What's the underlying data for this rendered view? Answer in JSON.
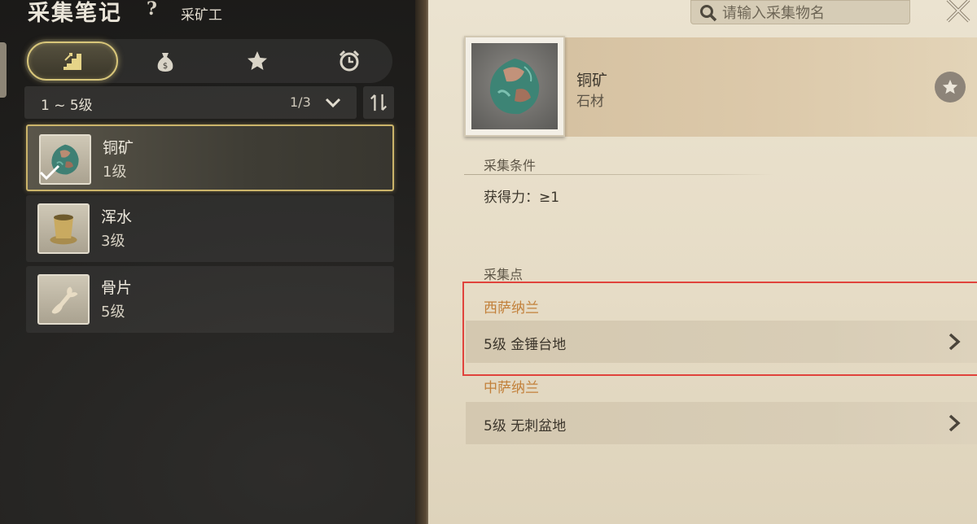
{
  "header": {
    "title": "采集笔记",
    "help_label": "?",
    "profession": "采矿工"
  },
  "tabs": [
    {
      "icon": "level-stairs-icon",
      "active": true
    },
    {
      "icon": "money-bag-icon",
      "active": false
    },
    {
      "icon": "star-icon",
      "active": false
    },
    {
      "icon": "alarm-clock-icon",
      "active": false
    }
  ],
  "filter": {
    "level_range": "1 ~ 5级",
    "page": "1/3"
  },
  "items": [
    {
      "name": "铜矿",
      "level": "1级",
      "icon": "copper-ore-icon",
      "selected": true,
      "checked": true
    },
    {
      "name": "浑水",
      "level": "3级",
      "icon": "muddy-water-cup-icon",
      "selected": false,
      "checked": false
    },
    {
      "name": "骨片",
      "level": "5级",
      "icon": "bone-fragment-icon",
      "selected": false,
      "checked": false
    }
  ],
  "search": {
    "placeholder": "请输入采集物名"
  },
  "detail": {
    "name": "铜矿",
    "type": "石材",
    "condition_title": "采集条件",
    "condition": "获得力：≥1",
    "points_title": "采集点",
    "regions": [
      {
        "name": "西萨纳兰",
        "location": "5级  金锤台地"
      },
      {
        "name": "中萨纳兰",
        "location": "5级  无刺盆地"
      }
    ]
  },
  "colors": {
    "accent_gold": "#cbb46a",
    "region_orange": "#c2803a",
    "highlight_red": "#e0433c"
  }
}
